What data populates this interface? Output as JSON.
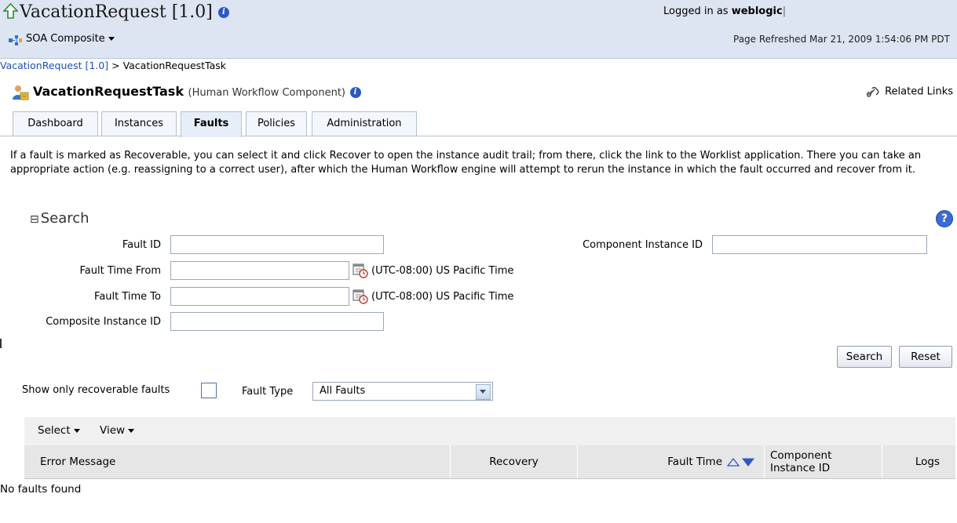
{
  "header": {
    "title": "VacationRequest [1.0]",
    "composite_menu": "SOA Composite",
    "logged_in_prefix": "Logged in as",
    "user": "weblogic",
    "page_refreshed": "Page Refreshed Mar 21, 2009 1:54:06 PM PDT"
  },
  "breadcrumb": {
    "root": "VacationRequest [1.0]",
    "sep": ">",
    "current": "VacationRequestTask"
  },
  "component": {
    "name": "VacationRequestTask",
    "type": "(Human Workflow Component)",
    "related_links": "Related Links"
  },
  "tabs": [
    {
      "label": "Dashboard"
    },
    {
      "label": "Instances"
    },
    {
      "label": "Faults",
      "active": true
    },
    {
      "label": "Policies"
    },
    {
      "label": "Administration"
    }
  ],
  "description": "If a fault is marked as Recoverable, you can select it and click Recover to open the instance audit trail; from there, click the link to the Worklist application. There you can take an appropriate action (e.g. reassigning to a correct user), after which the Human Workflow engine will attempt to rerun the instance in which the fault occurred and recover from it.",
  "search": {
    "heading": "Search",
    "collapse_glyph": "⊟",
    "fault_id_label": "Fault ID",
    "fault_id_value": "",
    "component_instance_label": "Component Instance ID",
    "component_instance_value": "",
    "time_from_label": "Fault Time From",
    "time_from_value": "",
    "time_to_label": "Fault Time To",
    "time_to_value": "",
    "timezone": "(UTC-08:00) US Pacific Time",
    "composite_instance_label": "Composite Instance ID",
    "composite_instance_value": "",
    "search_btn": "Search",
    "reset_btn": "Reset"
  },
  "filters": {
    "recoverable_label": "Show only recoverable faults",
    "recoverable_checked": false,
    "fault_type_label": "Fault Type",
    "fault_type_value": "All Faults"
  },
  "table": {
    "select_menu": "Select",
    "view_menu": "View",
    "columns": {
      "error_message": "Error Message",
      "recovery": "Recovery",
      "fault_time": "Fault Time",
      "component_instance_l1": "Component",
      "component_instance_l2": "Instance ID",
      "logs": "Logs"
    },
    "empty_text": "No faults found"
  },
  "colors": {
    "header_bg": "#dde5f3",
    "link": "#1b4fbb",
    "info_icon": "#2b58c6"
  }
}
